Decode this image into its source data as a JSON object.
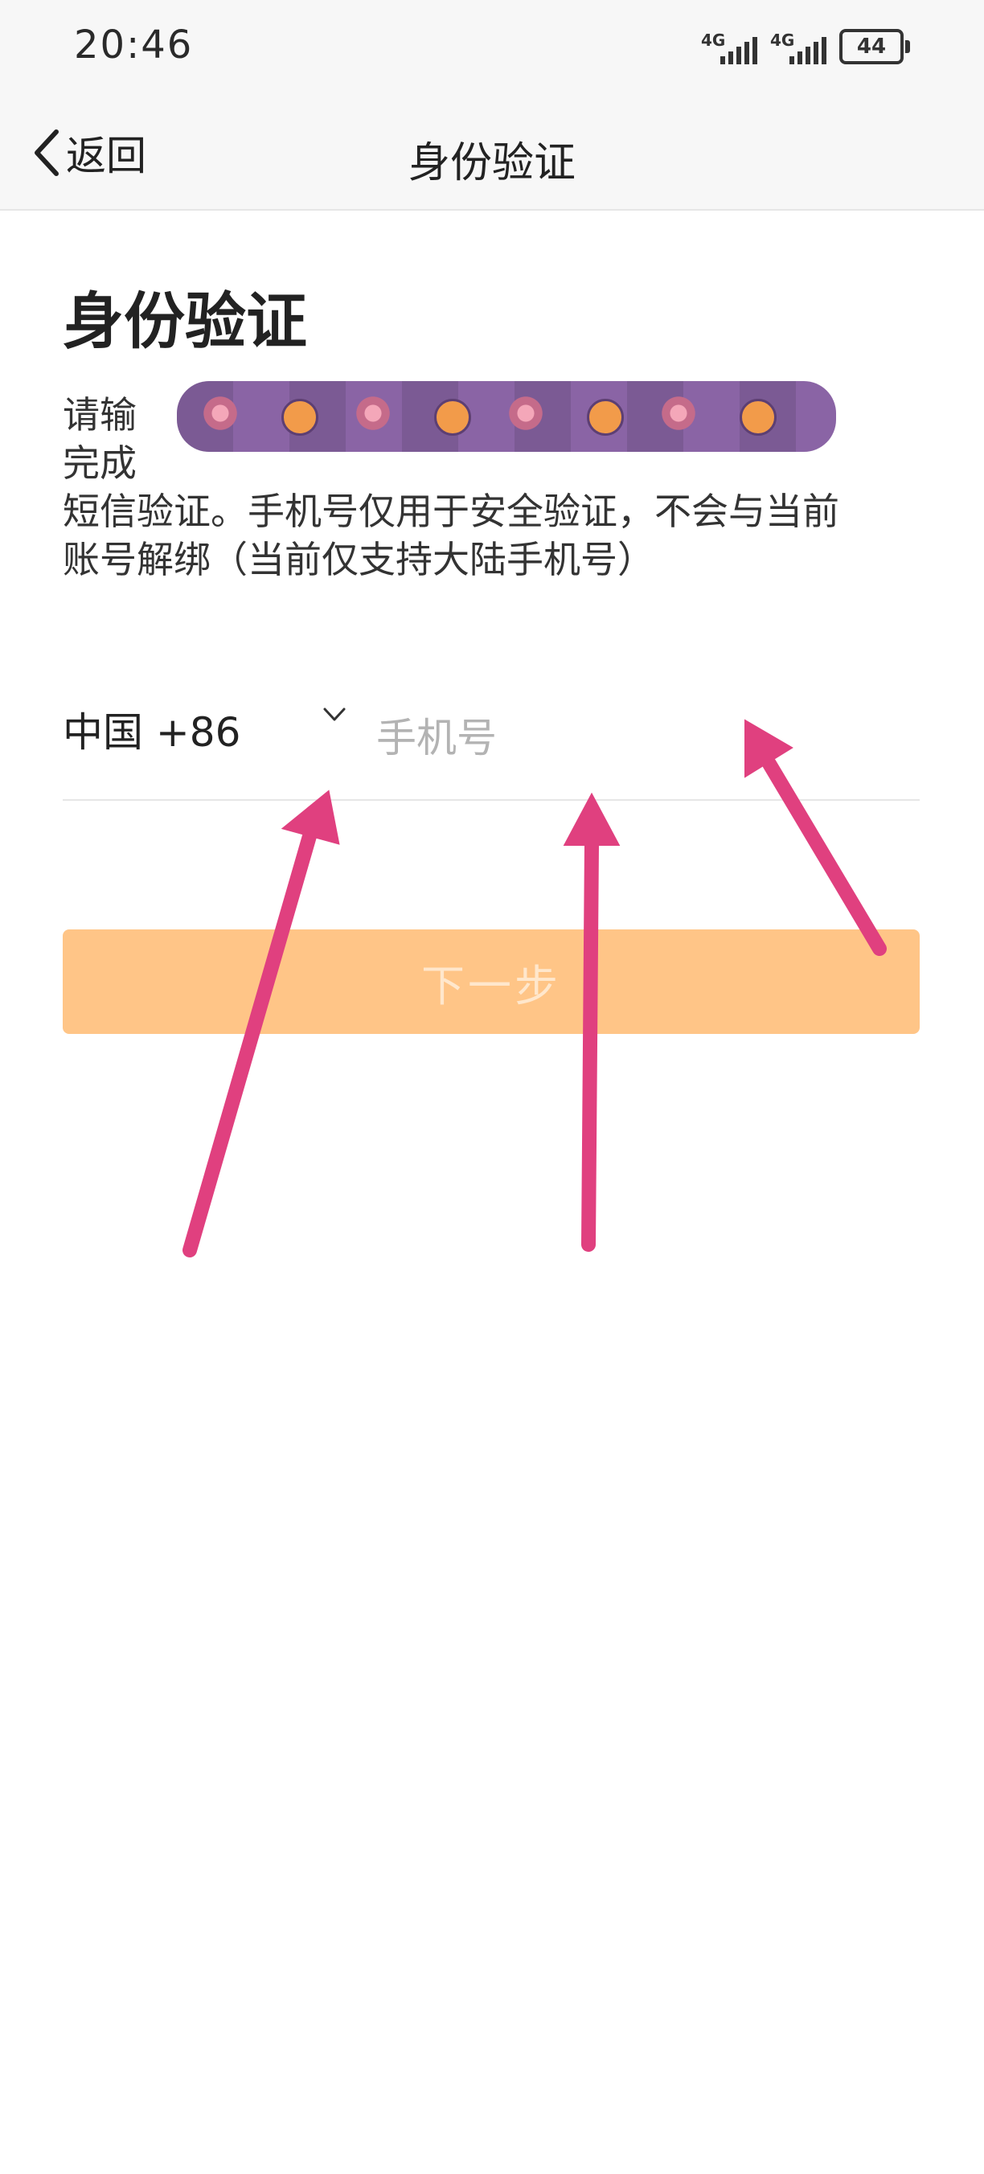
{
  "status_bar": {
    "time": "20:46",
    "network_1": "4G",
    "network_2": "4G",
    "battery": "44"
  },
  "nav": {
    "back_label": "返回",
    "title": "身份验证"
  },
  "main": {
    "heading": "身份验证",
    "description_start": "请输",
    "description_end": "完成",
    "description_line2": "短信验证。手机号仅用于安全验证，不会与当前",
    "description_line3": "账号解绑（当前仅支持大陆手机号）",
    "country_code": "中国 +86",
    "phone_placeholder": "手机号",
    "next_button": "下一步"
  },
  "colors": {
    "accent_disabled": "#ffc587",
    "annotation_arrow": "#e0407f"
  },
  "icons": {
    "back": "chevron-left-icon",
    "country_dropdown": "chevron-down-icon"
  }
}
